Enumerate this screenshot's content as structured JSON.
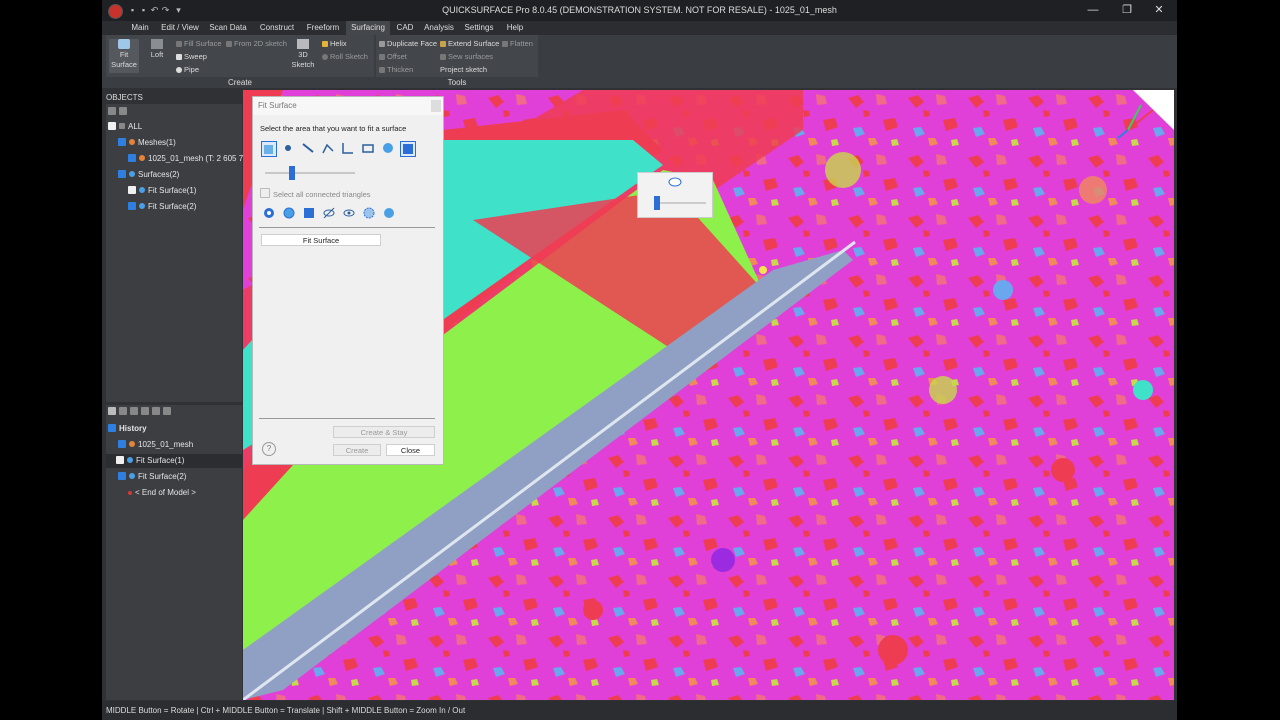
{
  "window": {
    "title": "QUICKSURFACE Pro 8.0.45 (DEMONSTRATION SYSTEM. NOT FOR RESALE) - 1025_01_mesh",
    "minimize": "—",
    "maximize": "❐",
    "close": "✕"
  },
  "menu": [
    "Main",
    "Edit / View",
    "Scan Data",
    "Construct",
    "Freeform",
    "Surfacing",
    "CAD",
    "Analysis",
    "Settings",
    "Help"
  ],
  "ribbon": {
    "create": {
      "label": "Create",
      "fit_surface": "Fit Surface",
      "loft": "Loft",
      "fill_surface": "Fill Surface",
      "from_2d_sketch": "From 2D sketch",
      "sweep": "Sweep",
      "pipe": "Pipe",
      "sketch_3d": "3D Sketch",
      "helix": "Helix",
      "roll_sketch": "Roll Sketch"
    },
    "tools": {
      "label": "Tools",
      "duplicate_face": "Duplicate Face",
      "extend_surface": "Extend Surface",
      "flatten": "Flatten",
      "offset": "Offset",
      "sew_surfaces": "Sew surfaces",
      "thicken": "Thicken",
      "project_sketch": "Project sketch"
    }
  },
  "objects": {
    "header": "OBJECTS",
    "all": "ALL",
    "meshes": "Meshes(1)",
    "mesh_item": "1025_01_mesh (T: 2 605 7",
    "surfaces": "Surfaces(2)",
    "fit1": "Fit Surface(1)",
    "fit2": "Fit Surface(2)"
  },
  "history": {
    "header": "History",
    "items": [
      "1025_01_mesh",
      "Fit Surface(1)",
      "Fit Surface(2)",
      "< End of Model >"
    ]
  },
  "dialog": {
    "title": "Fit Surface",
    "instruction": "Select the area that you want to fit a surface",
    "select_connected": "Select all connected triangles",
    "fit_button": "Fit Surface",
    "create_stay": "Create & Stay",
    "create": "Create",
    "close": "Close",
    "help": "?",
    "slider_level": 0.28
  },
  "status": "MIDDLE Button = Rotate | Ctrl + MIDDLE Button = Translate | Shift + MIDDLE Button = Zoom In / Out",
  "colors": {
    "magenta": "#e040d8",
    "red": "#ee3d52",
    "green": "#8ef04a",
    "cyan": "#3fe1c8",
    "accent": "#2f7fe0"
  }
}
